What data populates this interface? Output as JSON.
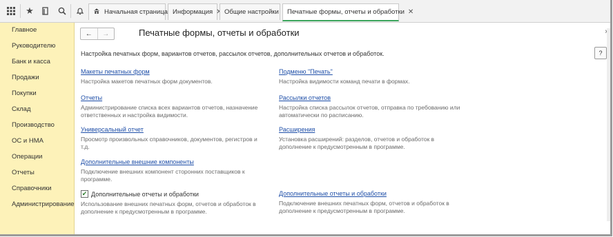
{
  "toolbar": {
    "icons": [
      "apps-grid-icon",
      "star-icon",
      "history-icon",
      "search-icon",
      "bell-icon"
    ]
  },
  "tabs": [
    {
      "label": "Начальная страница",
      "icon": "home-icon",
      "closable": false,
      "active": false
    },
    {
      "label": "Информация",
      "closable": true,
      "active": false
    },
    {
      "label": "Общие настройки",
      "closable": true,
      "active": false
    },
    {
      "label": "Печатные формы, отчеты и обработки",
      "closable": true,
      "active": true
    }
  ],
  "sidebar": {
    "items": [
      {
        "label": "Главное"
      },
      {
        "label": "Руководителю"
      },
      {
        "label": "Банк и касса"
      },
      {
        "label": "Продажи"
      },
      {
        "label": "Покупки"
      },
      {
        "label": "Склад"
      },
      {
        "label": "Производство"
      },
      {
        "label": "ОС и НМА"
      },
      {
        "label": "Операции"
      },
      {
        "label": "Отчеты"
      },
      {
        "label": "Справочники"
      },
      {
        "label": "Администрирование"
      }
    ]
  },
  "main": {
    "nav_back": "←",
    "nav_forward": "→",
    "title": "Печатные формы, отчеты и обработки",
    "close_glyph": "×",
    "description": "Настройка печатных форм, вариантов отчетов, рассылок отчетов, дополнительных отчетов и обработок.",
    "help_label": "?",
    "left": [
      {
        "link": "Макеты печатных форм",
        "hint": "Настройка макетов печатных форм документов."
      },
      {
        "link": "Отчеты",
        "hint": "Администрирование списка всех вариантов отчетов, назначение ответственных и настройка видимости."
      },
      {
        "link": "Универсальный отчет",
        "hint": "Просмотр произвольных справочников, документов, регистров и т.д."
      },
      {
        "link": "Дополнительные внешние компоненты",
        "hint": "Подключение внешних компонент сторонних поставщиков к программе."
      }
    ],
    "checkbox": {
      "label": "Дополнительные отчеты и обработки",
      "checked": true,
      "hint": "Использование внешних печатных форм, отчетов и обработок в дополнение к предусмотренным в программе."
    },
    "right": [
      {
        "link": "Подменю \"Печать\"",
        "hint": "Настройка видимости команд печати в формах."
      },
      {
        "link": "Рассылки отчетов",
        "hint": "Настройка списка рассылок отчетов, отправка по требованию или автоматически по расписанию."
      },
      {
        "link": "Расширения",
        "hint": "Установка расширений: разделов, отчетов и обработок в дополнение к предусмотренным в программе."
      },
      {
        "link": "Дополнительные отчеты и обработки",
        "hint": "Подключение внешних печатных форм, отчетов и обработок в дополнение к предусмотренным в программе."
      }
    ]
  },
  "colors": {
    "sidebar_bg": "#fdf2b9",
    "link": "#1f4fa8",
    "active_tab_accent": "#3ba55c"
  }
}
